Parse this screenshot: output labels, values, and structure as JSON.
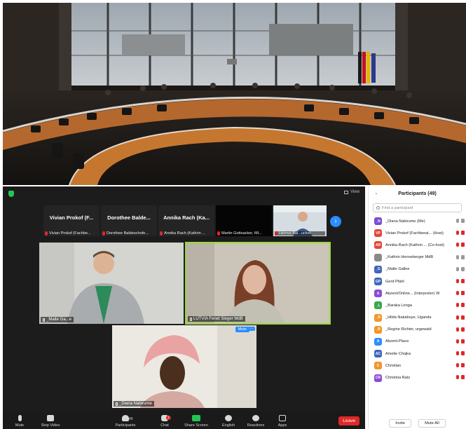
{
  "zoom": {
    "view_label": "View",
    "thumbnails": [
      {
        "name": "Vivian Prokof (F...",
        "label": "Vivian Prokof (Fachbe..."
      },
      {
        "name": "Dorothee Balde...",
        "label": "Dorothee Baldeschofe..."
      },
      {
        "name": "Annika Rach (Ka...",
        "label": "Annika Rach (Kathrin ..."
      },
      {
        "name": "",
        "label": "Martin Gottsacker, MI..."
      },
      {
        "name": "",
        "label": "Helmut Bal...ucker"
      }
    ],
    "tiles": {
      "speaker1": "_Malte Ga...e",
      "speaker2": "LUTVIA Fenet Sieger MdB",
      "speaker3": "_Diana Nabirume",
      "mute_label": "Mute"
    },
    "toolbar": {
      "mute": "Mute",
      "stop_video": "Stop Video",
      "participants": "Participants",
      "participants_count": "49",
      "chat": "Chat",
      "chat_badge": "1",
      "share_screen": "Share Screen",
      "english": "English",
      "reactions": "Reactions",
      "apps": "Apps",
      "leave": "Leave"
    }
  },
  "panel": {
    "title": "Participants (49)",
    "search_placeholder": "Find a participant",
    "participants": [
      {
        "initials": "_N",
        "name": "_Diana Nabirume (Me)",
        "color": "#7b4ccf",
        "muted": false
      },
      {
        "initials": "VP",
        "name": "Vivian Prokof (Fachberat... (Host)",
        "color": "#e0463a",
        "muted": true
      },
      {
        "initials": "AR",
        "name": "Annika Rach (Kathrin ... (Co-host)",
        "color": "#e0463a",
        "muted": true
      },
      {
        "initials": "",
        "name": "_Kathrin Henneberger MdB",
        "color": "#8a8a8a",
        "muted": false
      },
      {
        "initials": "_G",
        "name": "_Malte Gallee",
        "color": "#3f66b8",
        "muted": false
      },
      {
        "initials": "GP",
        "name": "Gerd Pfahl",
        "color": "#3f66b8",
        "muted": true
      },
      {
        "initials": "A",
        "name": "Akzent/Online... (Interpreter) W",
        "color": "#8a4cd6",
        "muted": true
      },
      {
        "initials": "_L",
        "name": "_Baraka Lenga",
        "color": "#3aa64a",
        "muted": true
      },
      {
        "initials": "_N",
        "name": "_Hilda Nakabuye, Uganda",
        "color": "#f0962a",
        "muted": true
      },
      {
        "initials": "_R",
        "name": "_Regine Richter, urgewald",
        "color": "#f0962a",
        "muted": true
      },
      {
        "initials": "A",
        "name": "Akzent-Plaza",
        "color": "#2d8cff",
        "muted": true
      },
      {
        "initials": "AC",
        "name": "Amelie Chojka",
        "color": "#3f66b8",
        "muted": true
      },
      {
        "initials": "C",
        "name": "Christian",
        "color": "#f0962a",
        "muted": true
      },
      {
        "initials": "CR",
        "name": "Christina Ratz",
        "color": "#8a4cd6",
        "muted": true
      }
    ],
    "invite_label": "Invite",
    "mute_all_label": "Mute All"
  }
}
